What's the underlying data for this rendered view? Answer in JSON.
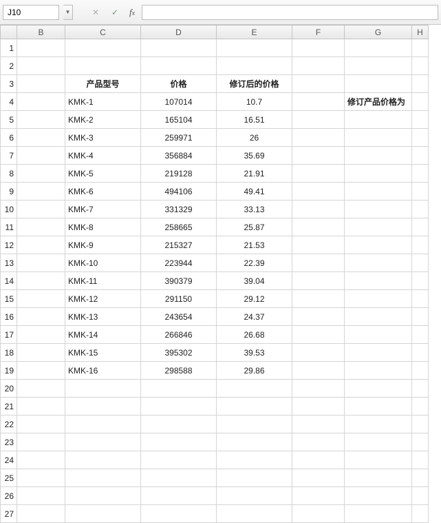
{
  "name_box": {
    "ref": "J10"
  },
  "formula": "",
  "columns": [
    "B",
    "C",
    "D",
    "E",
    "F",
    "G",
    "H"
  ],
  "row_start": 1,
  "row_end": 27,
  "headers": {
    "C": "产品型号",
    "D": "价格",
    "E": "修订后的价格"
  },
  "note_G4": "修订产品价格为",
  "data_rows": [
    {
      "model": "KMK-1",
      "price": "107014",
      "revised": "10.7"
    },
    {
      "model": "KMK-2",
      "price": "165104",
      "revised": "16.51"
    },
    {
      "model": "KMK-3",
      "price": "259971",
      "revised": "26"
    },
    {
      "model": "KMK-4",
      "price": "356884",
      "revised": "35.69"
    },
    {
      "model": "KMK-5",
      "price": "219128",
      "revised": "21.91"
    },
    {
      "model": "KMK-6",
      "price": "494106",
      "revised": "49.41"
    },
    {
      "model": "KMK-7",
      "price": "331329",
      "revised": "33.13"
    },
    {
      "model": "KMK-8",
      "price": "258665",
      "revised": "25.87"
    },
    {
      "model": "KMK-9",
      "price": "215327",
      "revised": "21.53"
    },
    {
      "model": "KMK-10",
      "price": "223944",
      "revised": "22.39"
    },
    {
      "model": "KMK-11",
      "price": "390379",
      "revised": "39.04"
    },
    {
      "model": "KMK-12",
      "price": "291150",
      "revised": "29.12"
    },
    {
      "model": "KMK-13",
      "price": "243654",
      "revised": "24.37"
    },
    {
      "model": "KMK-14",
      "price": "266846",
      "revised": "26.68"
    },
    {
      "model": "KMK-15",
      "price": "395302",
      "revised": "39.53"
    },
    {
      "model": "KMK-16",
      "price": "298588",
      "revised": "29.86"
    }
  ],
  "chart_data": {
    "type": "table",
    "title": "",
    "columns": [
      "产品型号",
      "价格",
      "修订后的价格"
    ],
    "rows": [
      [
        "KMK-1",
        107014,
        10.7
      ],
      [
        "KMK-2",
        165104,
        16.51
      ],
      [
        "KMK-3",
        259971,
        26
      ],
      [
        "KMK-4",
        356884,
        35.69
      ],
      [
        "KMK-5",
        219128,
        21.91
      ],
      [
        "KMK-6",
        494106,
        49.41
      ],
      [
        "KMK-7",
        331329,
        33.13
      ],
      [
        "KMK-8",
        258665,
        25.87
      ],
      [
        "KMK-9",
        215327,
        21.53
      ],
      [
        "KMK-10",
        223944,
        22.39
      ],
      [
        "KMK-11",
        390379,
        39.04
      ],
      [
        "KMK-12",
        291150,
        29.12
      ],
      [
        "KMK-13",
        243654,
        24.37
      ],
      [
        "KMK-14",
        266846,
        26.68
      ],
      [
        "KMK-15",
        395302,
        39.53
      ],
      [
        "KMK-16",
        298588,
        29.86
      ]
    ]
  }
}
